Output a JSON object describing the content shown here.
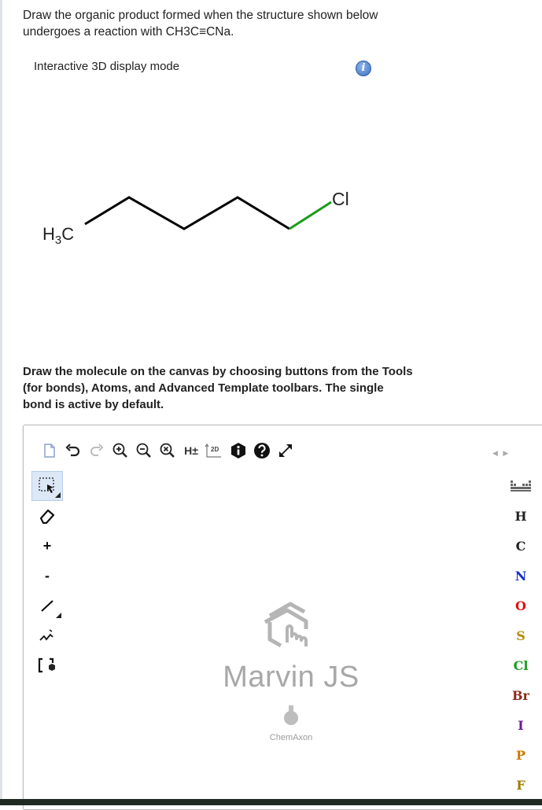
{
  "question": {
    "line1": "Draw the organic product formed when the structure shown below",
    "line2_prefix": "undergoes a reaction with CH",
    "line2_sub": "3",
    "line2_suffix": "C≡CNa."
  },
  "display_mode_label": "Interactive 3D display mode",
  "info_icon_glyph": "i",
  "molecule": {
    "left_group": "H",
    "left_group_sub": "3",
    "left_group_tail": "C",
    "right_atom": "Cl",
    "bond_color": "#000000",
    "cl_bond_color": "#1a9c1a"
  },
  "instructions": {
    "line1": "Draw the molecule on the canvas by choosing buttons from the Tools",
    "line2": "(for bonds), Atoms, and Advanced Template toolbars. The single",
    "line3": "bond is active by default."
  },
  "toolbar": {
    "hydrogens_label": "H±",
    "clean2d_label": "2D",
    "nav_arrows": "◀ ▶"
  },
  "left_tools": {
    "charge_plus": "+",
    "charge_minus": "-"
  },
  "atoms": [
    {
      "symbol": "H",
      "color": "#222222"
    },
    {
      "symbol": "C",
      "color": "#222222"
    },
    {
      "symbol": "N",
      "color": "#1a2fd0"
    },
    {
      "symbol": "O",
      "color": "#e01010"
    },
    {
      "symbol": "S",
      "color": "#b58a00"
    },
    {
      "symbol": "Cl",
      "color": "#1a9c1a"
    },
    {
      "symbol": "Br",
      "color": "#8b2a1a"
    },
    {
      "symbol": "I",
      "color": "#6a1a9a"
    },
    {
      "symbol": "P",
      "color": "#d07800"
    },
    {
      "symbol": "F",
      "color": "#a07a00"
    }
  ],
  "canvas_logo": {
    "title": "Marvin JS",
    "vendor": "ChemAxon"
  }
}
